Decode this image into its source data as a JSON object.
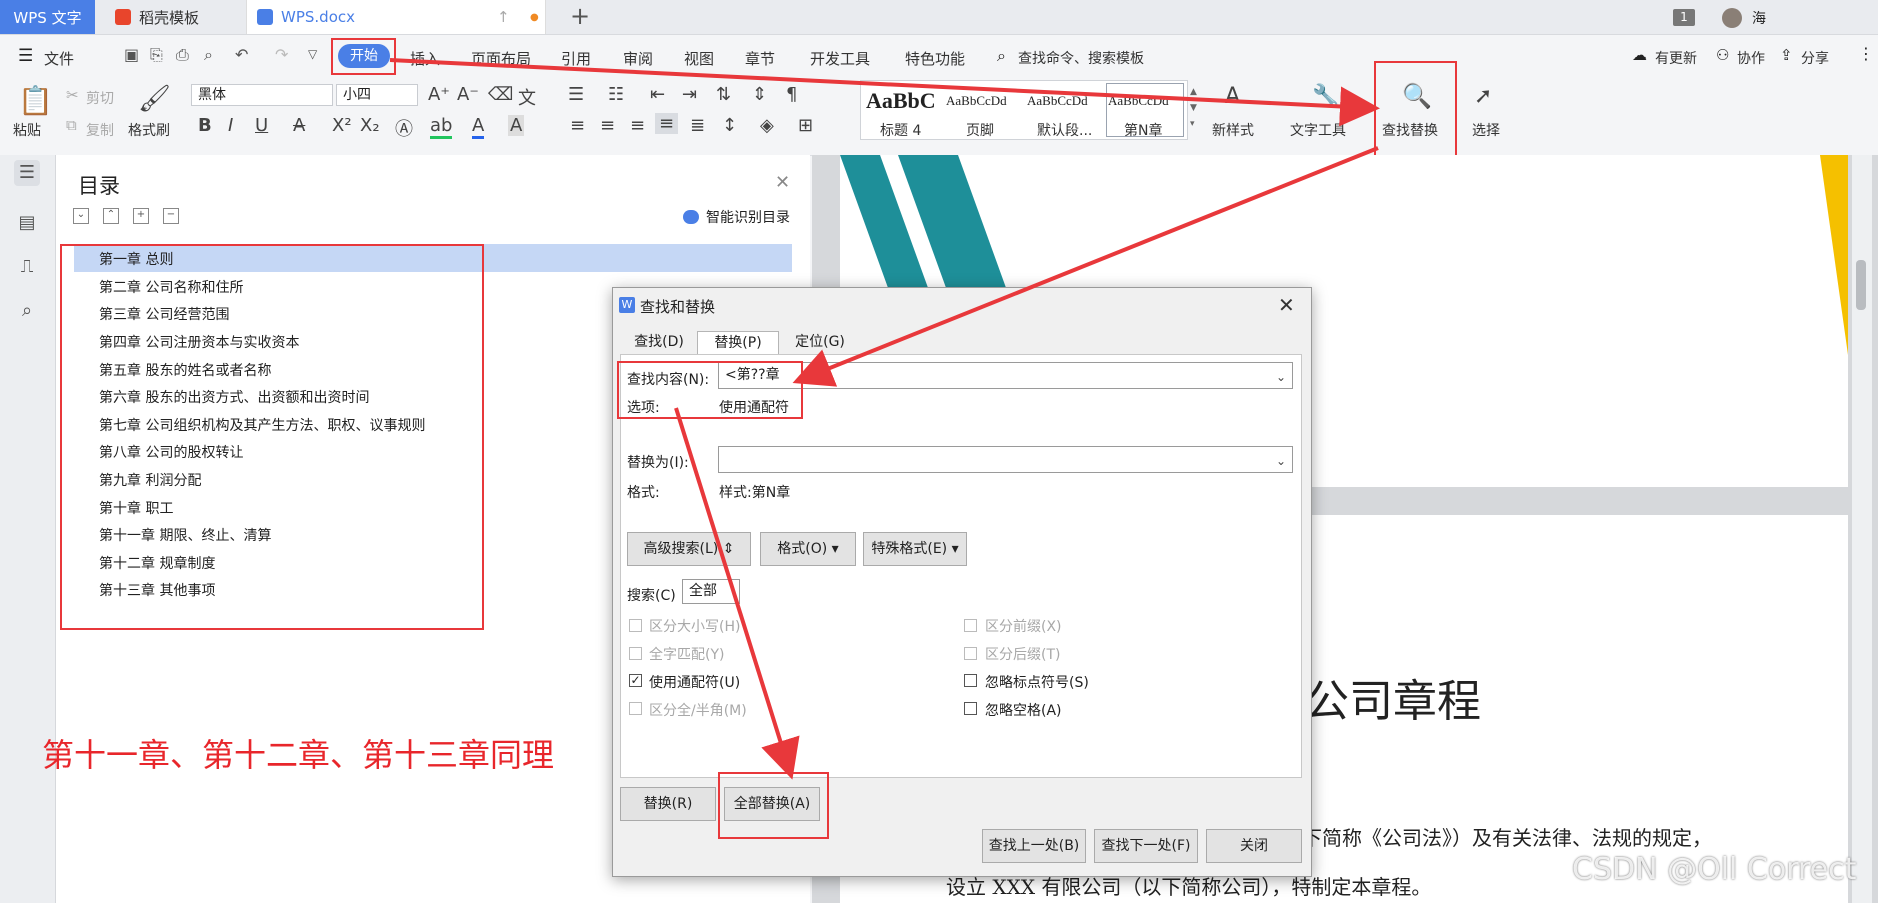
{
  "tabs": {
    "app": "WPS 文字",
    "template": "稻壳模板",
    "doc": "WPS.docx",
    "new_tab": "+"
  },
  "header": {
    "badge": "1",
    "user": "海"
  },
  "menu": {
    "file": "文件",
    "items": [
      "开始",
      "插入",
      "页面布局",
      "引用",
      "审阅",
      "视图",
      "章节",
      "开发工具",
      "特色功能"
    ],
    "search": "查找命令、搜索模板",
    "update": "有更新",
    "collab": "协作",
    "share": "分享"
  },
  "ribbon": {
    "paste": "粘贴",
    "cut": "剪切",
    "copy": "复制",
    "format_painter": "格式刷",
    "font": "黑体",
    "size": "小四",
    "styles": [
      {
        "sample": "AaBbC",
        "name": "标题 4"
      },
      {
        "sample": "AaBbCcDd",
        "name": "页脚"
      },
      {
        "sample": "AaBbCcDd",
        "name": "默认段..."
      },
      {
        "sample": "AaBbCcDd",
        "name": "第N章"
      }
    ],
    "new_style": "新样式",
    "text_tools": "文字工具",
    "find_replace": "查找替换",
    "select": "选择"
  },
  "toc": {
    "title": "目录",
    "smart": "智能识别目录",
    "items": [
      "第一章  总则",
      "第二章  公司名称和住所",
      "第三章  公司经营范围",
      "第四章  公司注册资本与实收资本",
      "第五章  股东的姓名或者名称",
      "第六章  股东的出资方式、出资额和出资时间",
      "第七章  公司组织机构及其产生方法、职权、议事规则",
      "第八章  公司的股权转让",
      "第九章  利润分配",
      "第十章  职工",
      "第十一章  期限、终止、清算",
      "第十二章  规章制度",
      "第十三章  其他事项"
    ]
  },
  "annotation": "第十一章、第十二章、第十三章同理",
  "document": {
    "title": "公司章程",
    "line1": "司法》（以下简称《公司法》）及有关法律、法规的规定，",
    "line2": "设立 XXX 有限公司（以下简称公司），特制定本章程。"
  },
  "watermark": "CSDN @Oll Correct",
  "dialog": {
    "title": "查找和替换",
    "tabs": [
      "查找(D)",
      "替换(P)",
      "定位(G)"
    ],
    "find_label": "查找内容(N):",
    "find_value": "<第??章",
    "options_label": "选项:",
    "options_value": "使用通配符",
    "replace_label": "替换为(I):",
    "replace_value": "",
    "format_label": "格式:",
    "format_value": "样式:第N章",
    "adv_search": "高级搜索(L)",
    "format_btn": "格式(O)",
    "special_btn": "特殊格式(E)",
    "search_label": "搜索(C)",
    "search_value": "全部",
    "options": {
      "match_case": "区分大小写(H)",
      "whole_word": "全字匹配(Y)",
      "wildcards": "使用通配符(U)",
      "half_full": "区分全/半角(M)",
      "prefix": "区分前缀(X)",
      "suffix": "区分后缀(T)",
      "ignore_punct": "忽略标点符号(S)",
      "ignore_space": "忽略空格(A)"
    },
    "replace_btn": "替换(R)",
    "replace_all_btn": "全部替换(A)",
    "find_prev": "查找上一处(B)",
    "find_next": "查找下一处(F)",
    "close": "关闭"
  },
  "colors": {
    "accent": "#4a7fe6",
    "highlight": "#e8383b",
    "teal": "#1e8f99"
  }
}
